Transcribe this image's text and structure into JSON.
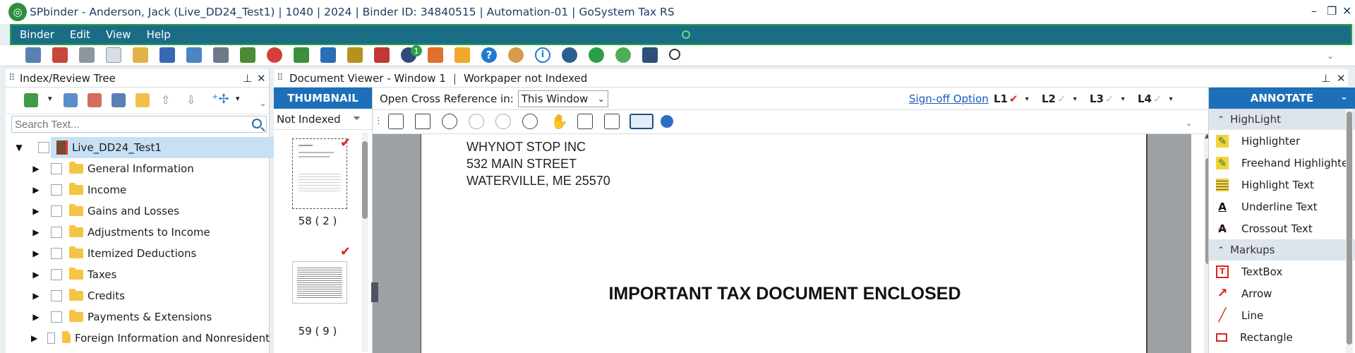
{
  "window": {
    "title": "SPbinder - Anderson, Jack (Live_DD24_Test1) | 1040 | 2024 | Binder ID: 34840515 | Automation-01 | GoSystem Tax RS"
  },
  "menu": [
    "Binder",
    "Edit",
    "View",
    "Help"
  ],
  "toolbar": {
    "badge_count": "1"
  },
  "left_panel": {
    "title": "Index/Review Tree",
    "search_placeholder": "Search Text...",
    "root": "Live_DD24_Test1",
    "items": [
      "General Information",
      "Income",
      "Gains and Losses",
      "Adjustments to Income",
      "Itemized Deductions",
      "Taxes",
      "Credits",
      "Payments & Extensions",
      "Foreign Information and Nonresident"
    ]
  },
  "viewer": {
    "title": "Document Viewer - Window 1",
    "status": "Workpaper not Indexed",
    "thumbnail_tab": "THUMBNAIL",
    "filter_value": "Not Indexed",
    "thumbs": [
      "58 ( 2 )",
      "59 ( 9 )"
    ],
    "xref_label": "Open Cross Reference in:",
    "xref_value": "This Window",
    "signoff": "Sign-off Option",
    "levels": [
      "L1",
      "L2",
      "L3",
      "L4"
    ]
  },
  "document": {
    "address": [
      "WHYNOT STOP INC",
      "532 MAIN STREET",
      "WATERVILLE, ME 25570"
    ],
    "heading": "IMPORTANT TAX DOCUMENT ENCLOSED"
  },
  "annotate": {
    "tab": "ANNOTATE",
    "section1": "HighLight",
    "items1": [
      "Highlighter",
      "Freehand Highlighter",
      "Highlight Text",
      "Underline Text",
      "Crossout Text"
    ],
    "section2": "Markups",
    "items2": [
      "TextBox",
      "Arrow",
      "Line",
      "Rectangle"
    ]
  },
  "colors": {
    "menu_bar": "#1b6d86",
    "accent_tab": "#1c6fb8",
    "tree_selected": "#c7e0f4",
    "check": "#d22222"
  }
}
